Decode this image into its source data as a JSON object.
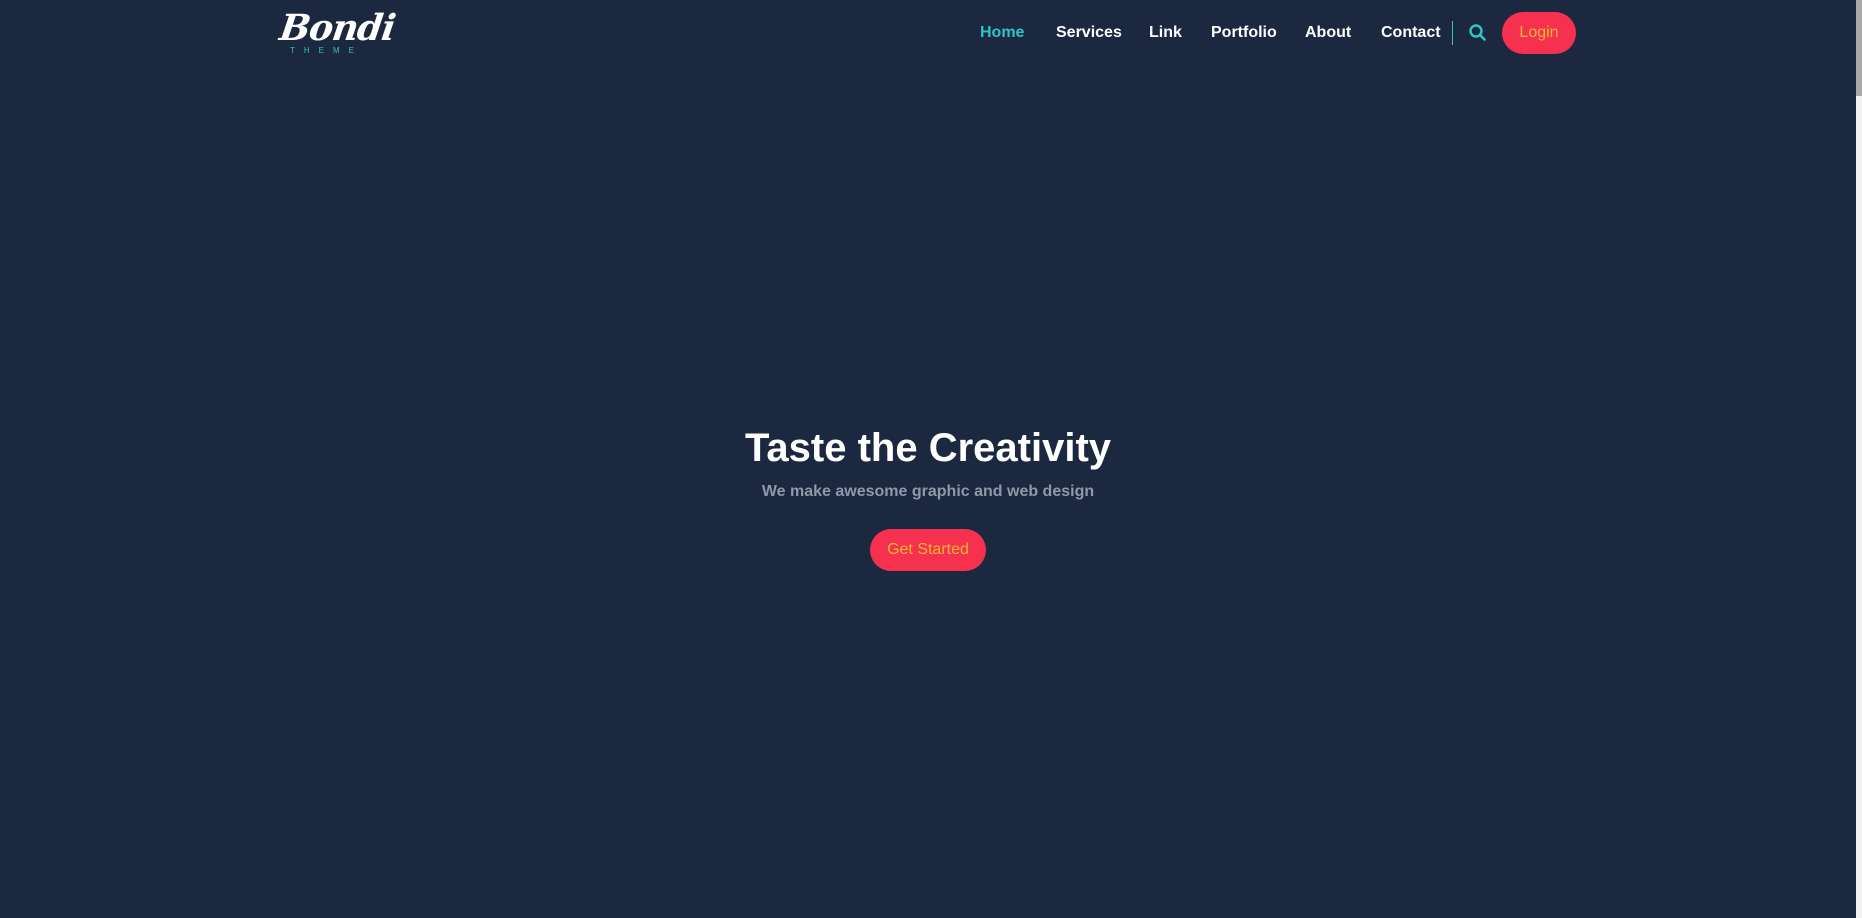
{
  "header": {
    "logo": {
      "word": "Bondi",
      "sub": "THEME"
    },
    "nav": [
      {
        "label": "Home",
        "active": true
      },
      {
        "label": "Services",
        "active": false
      },
      {
        "label": "Link",
        "active": false
      },
      {
        "label": "Portfolio",
        "active": false
      },
      {
        "label": "About",
        "active": false
      },
      {
        "label": "Contact",
        "active": false
      }
    ],
    "search_icon": "search-icon",
    "login_label": "Login"
  },
  "hero": {
    "title": "Taste the Creativity",
    "subtitle": "We make awesome graphic and web design",
    "cta_label": "Get Started"
  },
  "colors": {
    "background": "#1b2840",
    "accent": "#2ec5c9",
    "button_bg": "#f5314f",
    "button_text": "#f7b731"
  }
}
